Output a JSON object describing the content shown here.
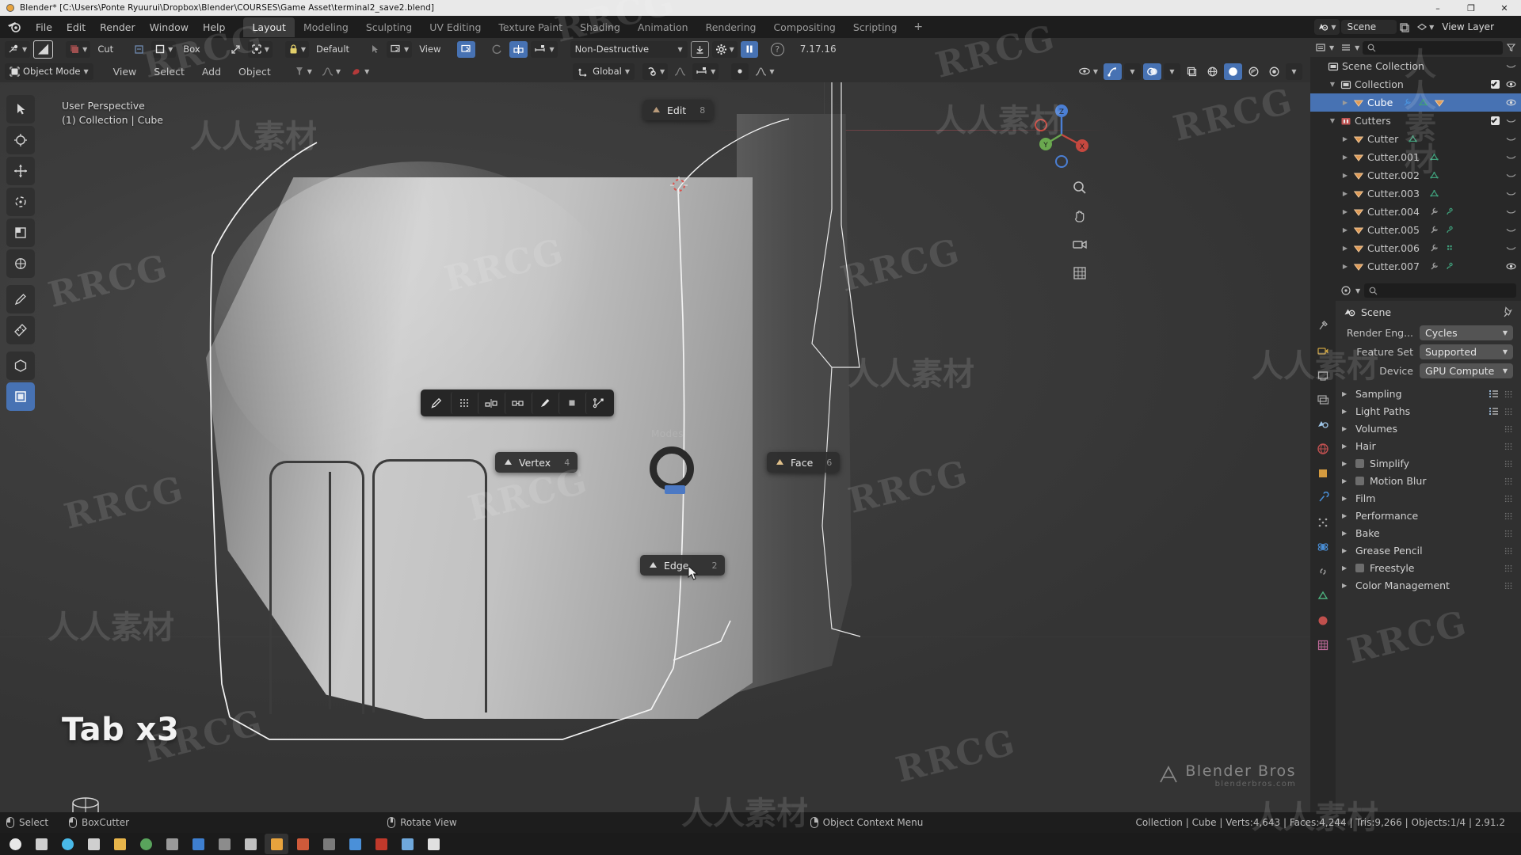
{
  "window": {
    "title": "Blender* [C:\\Users\\Ponte Ryuurui\\Dropbox\\Blender\\COURSES\\Game Asset\\terminal2_save2.blend]",
    "minimize": "–",
    "maximize": "❐",
    "close": "✕"
  },
  "topbar": {
    "menus": [
      "File",
      "Edit",
      "Render",
      "Window",
      "Help"
    ],
    "tabs": [
      {
        "label": "Layout",
        "active": true
      },
      {
        "label": "Modeling",
        "active": false
      },
      {
        "label": "Sculpting",
        "active": false
      },
      {
        "label": "UV Editing",
        "active": false
      },
      {
        "label": "Texture Paint",
        "active": false
      },
      {
        "label": "Shading",
        "active": false
      },
      {
        "label": "Animation",
        "active": false
      },
      {
        "label": "Rendering",
        "active": false
      },
      {
        "label": "Compositing",
        "active": false
      },
      {
        "label": "Scripting",
        "active": false
      }
    ],
    "add_tab": "+",
    "scene_name": "Scene",
    "view_layer_name": "View Layer"
  },
  "toolheader": {
    "cut_label": "Cut",
    "box_label": "Box",
    "default_label": "Default",
    "view_label": "View",
    "mode_label": "Non-Destructive",
    "version": "7.17.16",
    "help": "?"
  },
  "viewport_header": {
    "mode": "Object Mode",
    "menus": [
      "View",
      "Select",
      "Add",
      "Object"
    ],
    "orientation": "Global"
  },
  "viewport": {
    "overlay_line1": "User Perspective",
    "overlay_line2": "(1) Collection | Cube",
    "big_text": "Tab x3",
    "gizmo_axes": [
      "Z",
      "Y",
      "X"
    ],
    "watermark_brand_1": "Blender Bros",
    "watermark_brand_2": "blenderbros.com"
  },
  "pie_menu": {
    "title": "Modes",
    "items": [
      {
        "label": "Edit",
        "underline": "E",
        "num": "8",
        "pos": "top"
      },
      {
        "label": "Vertex",
        "underline": "V",
        "num": "4",
        "pos": "left"
      },
      {
        "label": "Face",
        "underline": "F",
        "num": "6",
        "pos": "right"
      },
      {
        "label": "Edge",
        "underline": "E",
        "num": "2",
        "pos": "bottom"
      }
    ]
  },
  "outliner": {
    "filter_placeholder": "",
    "rows": [
      {
        "name": "Scene Collection",
        "indent": 0,
        "tri": "",
        "selected": false,
        "icon": "scene-collection-icon",
        "check": false,
        "eye": false
      },
      {
        "name": "Collection",
        "indent": 1,
        "tri": "▼",
        "selected": false,
        "icon": "collection-icon",
        "check": true,
        "eye": true
      },
      {
        "name": "Cube",
        "indent": 2,
        "tri": "▶",
        "selected": true,
        "icon": "mesh-object-icon",
        "check": false,
        "eye": true
      },
      {
        "name": "Cutters",
        "indent": 1,
        "tri": "▼",
        "selected": false,
        "icon": "collection-red-icon",
        "check": true,
        "eye": false
      },
      {
        "name": "Cutter",
        "indent": 2,
        "tri": "▶",
        "selected": false,
        "icon": "mesh-object-icon",
        "check": false,
        "eye": false
      },
      {
        "name": "Cutter.001",
        "indent": 2,
        "tri": "▶",
        "selected": false,
        "icon": "mesh-object-icon",
        "check": false,
        "eye": false
      },
      {
        "name": "Cutter.002",
        "indent": 2,
        "tri": "▶",
        "selected": false,
        "icon": "mesh-object-icon",
        "check": false,
        "eye": false
      },
      {
        "name": "Cutter.003",
        "indent": 2,
        "tri": "▶",
        "selected": false,
        "icon": "mesh-object-icon",
        "check": false,
        "eye": false
      },
      {
        "name": "Cutter.004",
        "indent": 2,
        "tri": "▶",
        "selected": false,
        "icon": "mesh-object-icon",
        "check": false,
        "eye": false
      },
      {
        "name": "Cutter.005",
        "indent": 2,
        "tri": "▶",
        "selected": false,
        "icon": "mesh-object-icon",
        "check": false,
        "eye": false
      },
      {
        "name": "Cutter.006",
        "indent": 2,
        "tri": "▶",
        "selected": false,
        "icon": "mesh-object-icon",
        "check": false,
        "eye": false
      },
      {
        "name": "Cutter.007",
        "indent": 2,
        "tri": "▶",
        "selected": false,
        "icon": "mesh-object-icon",
        "check": false,
        "eye": true
      }
    ]
  },
  "properties": {
    "breadcrumb": "Scene",
    "fields": [
      {
        "label": "Render Eng...",
        "value": "Cycles"
      },
      {
        "label": "Feature Set",
        "value": "Supported"
      },
      {
        "label": "Device",
        "value": "GPU Compute"
      }
    ],
    "panels": [
      {
        "label": "Sampling",
        "checkbox": false,
        "list": true
      },
      {
        "label": "Light Paths",
        "checkbox": false,
        "list": true
      },
      {
        "label": "Volumes",
        "checkbox": false,
        "list": false
      },
      {
        "label": "Hair",
        "checkbox": false,
        "list": false
      },
      {
        "label": "Simplify",
        "checkbox": true,
        "list": false
      },
      {
        "label": "Motion Blur",
        "checkbox": true,
        "list": false
      },
      {
        "label": "Film",
        "checkbox": false,
        "list": false
      },
      {
        "label": "Performance",
        "checkbox": false,
        "list": false
      },
      {
        "label": "Bake",
        "checkbox": false,
        "list": false
      },
      {
        "label": "Grease Pencil",
        "checkbox": false,
        "list": false
      },
      {
        "label": "Freestyle",
        "checkbox": true,
        "list": false
      },
      {
        "label": "Color Management",
        "checkbox": false,
        "list": false
      }
    ]
  },
  "statusbar": {
    "hints": [
      {
        "mouse": "left",
        "text": "Select"
      },
      {
        "mouse": "left",
        "text": "BoxCutter"
      },
      {
        "mouse": "middle",
        "text": "Rotate View"
      },
      {
        "mouse": "right",
        "text": "Object Context Menu"
      }
    ],
    "stats": "Collection | Cube | Verts:4,643 | Faces:4,244 | Tris:9,266 | Objects:1/4 | 2.91.2"
  },
  "taskbar": {
    "items": [
      {
        "name": "start-button",
        "color": "#e8e8e8"
      },
      {
        "name": "search-button",
        "color": "#cfcfcf"
      },
      {
        "name": "cortana-button",
        "color": "#49b9e8"
      },
      {
        "name": "taskview-button",
        "color": "#cfcfcf"
      },
      {
        "name": "explorer-button",
        "color": "#e8b54a"
      },
      {
        "name": "chrome-button",
        "color": "#59a35c"
      },
      {
        "name": "app6-button",
        "color": "#9a9a9a"
      },
      {
        "name": "mail-button",
        "color": "#3e7fd0"
      },
      {
        "name": "app8-button",
        "color": "#8c8c8c"
      },
      {
        "name": "photos-button",
        "color": "#c0c0c0"
      },
      {
        "name": "blender-button",
        "color": "#e8a33d"
      },
      {
        "name": "app11-button",
        "color": "#cf5a3a"
      },
      {
        "name": "app12-button",
        "color": "#7a7a7a"
      },
      {
        "name": "app13-button",
        "color": "#4a90d9"
      },
      {
        "name": "word-button",
        "color": "#c0392b"
      },
      {
        "name": "app15-button",
        "color": "#6fa8dc"
      },
      {
        "name": "app16-button",
        "color": "#e0e0e0"
      }
    ]
  },
  "watermarks": {
    "rrcg": "RRCG",
    "cn": "人人素材"
  }
}
